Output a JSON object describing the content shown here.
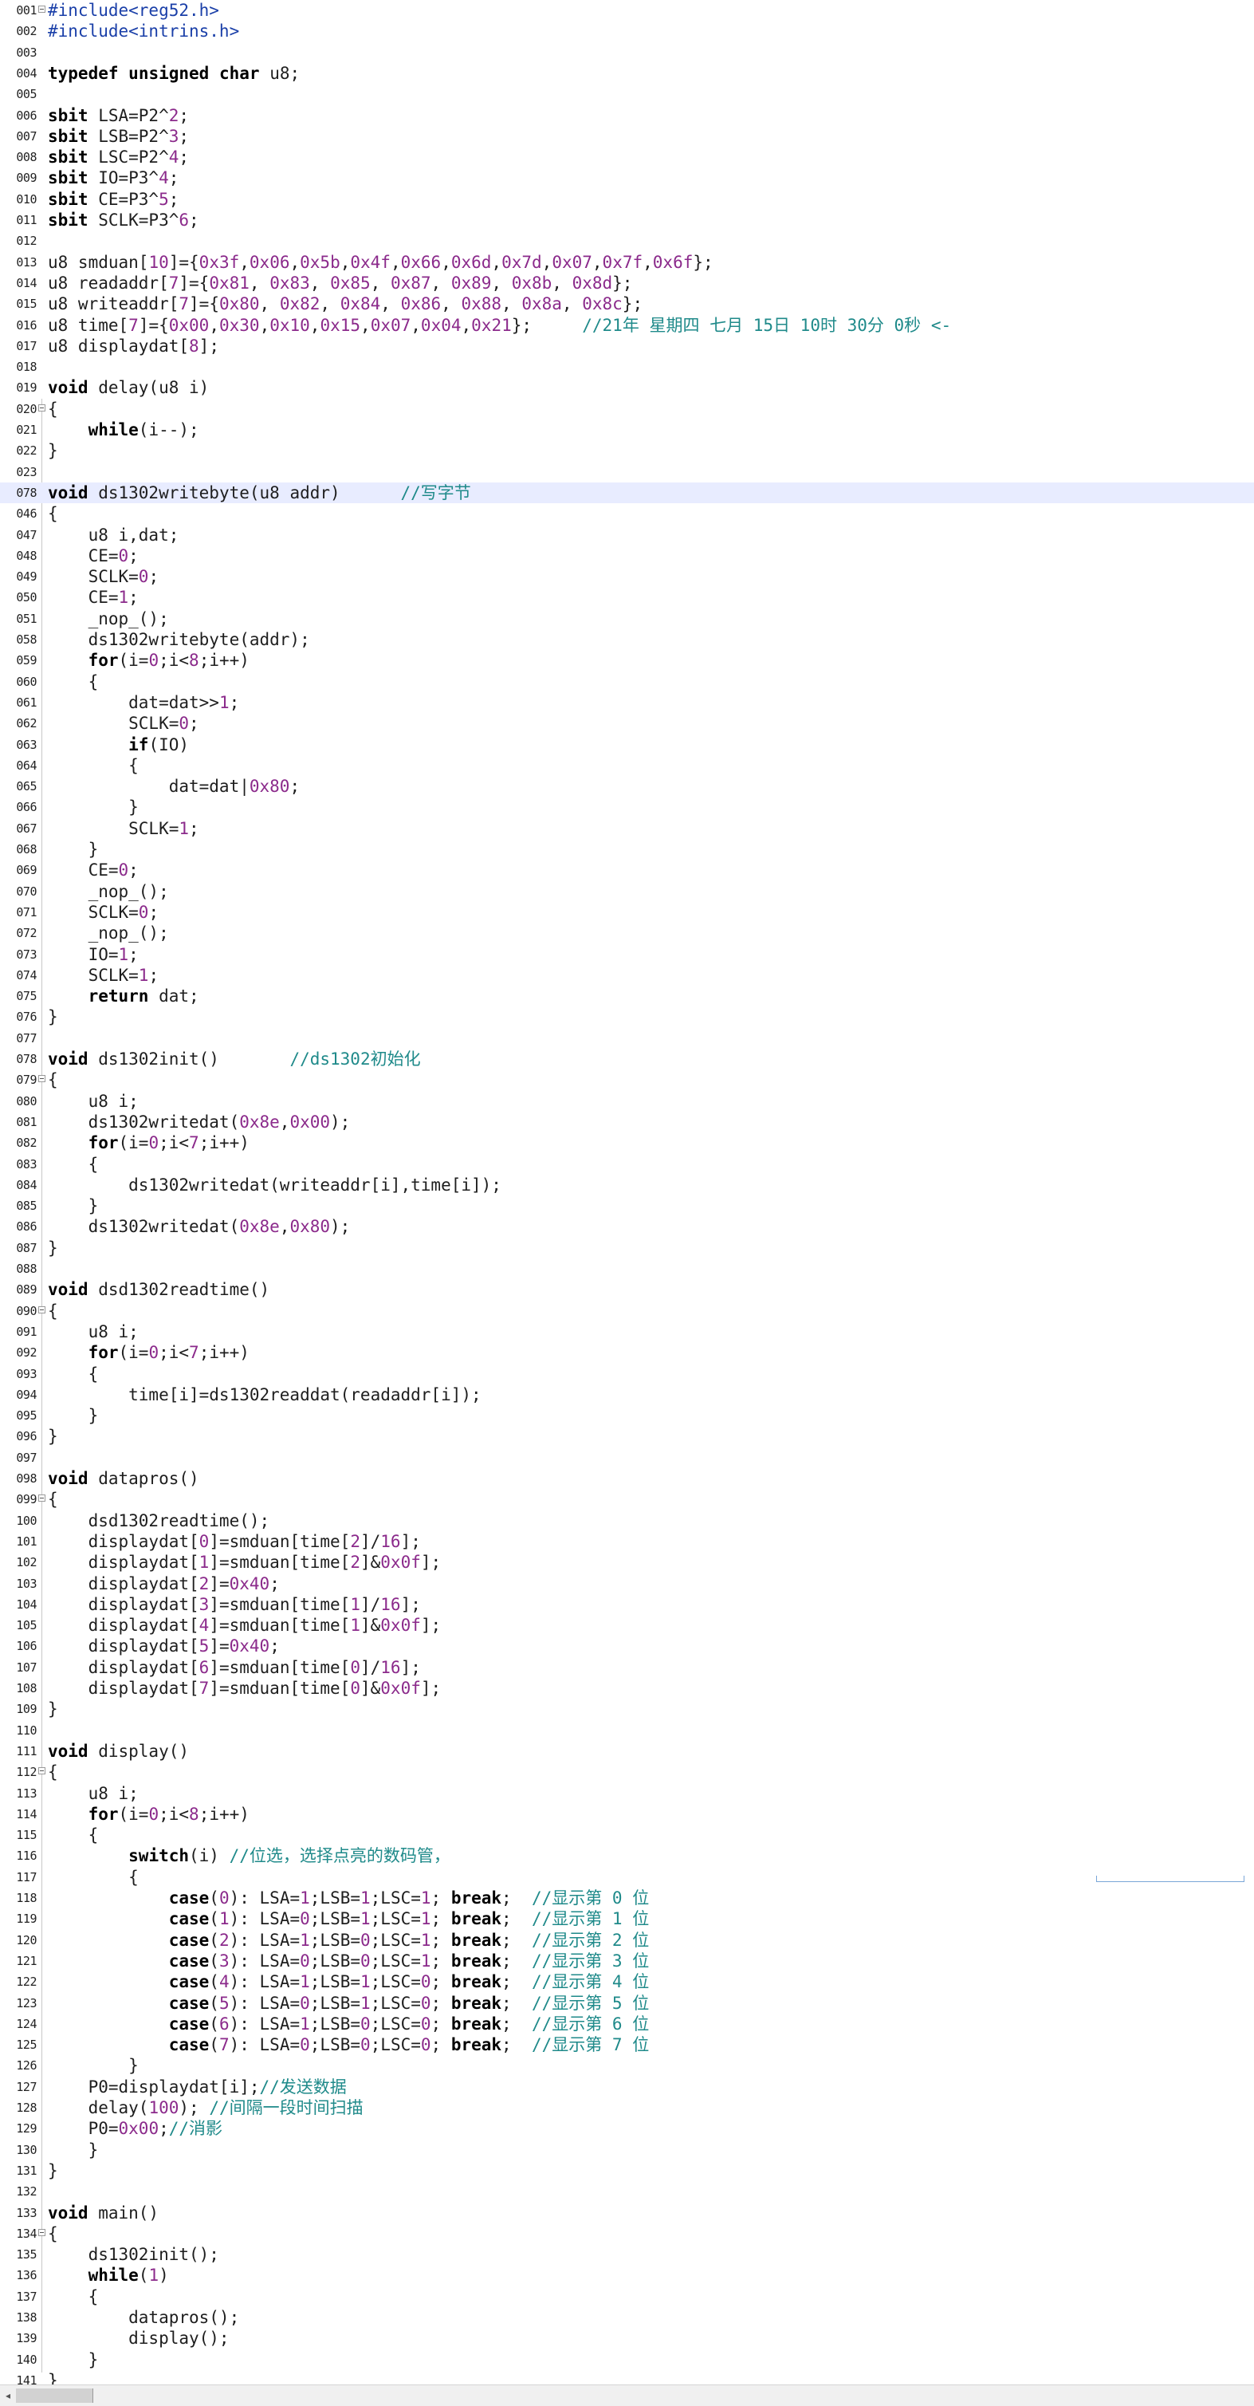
{
  "editor": {
    "lines": [
      {
        "n": "001",
        "fold": "box",
        "t": "#include<reg52.h>"
      },
      {
        "n": "002",
        "t": "#include<intrins.h>"
      },
      {
        "n": "003",
        "t": ""
      },
      {
        "n": "004",
        "t": "typedef unsigned char u8;"
      },
      {
        "n": "005",
        "t": ""
      },
      {
        "n": "006",
        "t": "sbit LSA=P2^2;"
      },
      {
        "n": "007",
        "t": "sbit LSB=P2^3;"
      },
      {
        "n": "008",
        "t": "sbit LSC=P2^4;"
      },
      {
        "n": "009",
        "t": "sbit IO=P3^4;"
      },
      {
        "n": "010",
        "t": "sbit CE=P3^5;"
      },
      {
        "n": "011",
        "t": "sbit SCLK=P3^6;"
      },
      {
        "n": "012",
        "t": ""
      },
      {
        "n": "013",
        "t": "u8 smduan[10]={0x3f,0x06,0x5b,0x4f,0x66,0x6d,0x7d,0x07,0x7f,0x6f};"
      },
      {
        "n": "014",
        "t": "u8 readaddr[7]={0x81, 0x83, 0x85, 0x87, 0x89, 0x8b, 0x8d};"
      },
      {
        "n": "015",
        "t": "u8 writeaddr[7]={0x80, 0x82, 0x84, 0x86, 0x88, 0x8a, 0x8c};"
      },
      {
        "n": "016",
        "t": "u8 time[7]={0x00,0x30,0x10,0x15,0x07,0x04,0x21};     //21年 星期四 七月 15日 10时 30分 0秒 <-"
      },
      {
        "n": "017",
        "t": "u8 displaydat[8];"
      },
      {
        "n": "018",
        "t": ""
      },
      {
        "n": "019",
        "t": "void delay(u8 i)"
      },
      {
        "n": "020",
        "fold": "box",
        "t": "{"
      },
      {
        "n": "021",
        "t": "    while(i--);"
      },
      {
        "n": "022",
        "t": "}"
      },
      {
        "n": "023",
        "t": ""
      },
      {
        "n": "078",
        "hl": true,
        "t": "void ds1302writebyte(u8 addr)      //写字节"
      },
      {
        "n": "046",
        "t": "{"
      },
      {
        "n": "047",
        "t": "    u8 i,dat;"
      },
      {
        "n": "048",
        "t": "    CE=0;"
      },
      {
        "n": "049",
        "t": "    SCLK=0;"
      },
      {
        "n": "050",
        "t": "    CE=1;"
      },
      {
        "n": "051",
        "t": "    _nop_();"
      },
      {
        "n": "058",
        "t": "    ds1302writebyte(addr);"
      },
      {
        "n": "059",
        "t": "    for(i=0;i<8;i++)"
      },
      {
        "n": "060",
        "t": "    {"
      },
      {
        "n": "061",
        "t": "        dat=dat>>1;"
      },
      {
        "n": "062",
        "t": "        SCLK=0;"
      },
      {
        "n": "063",
        "t": "        if(IO)"
      },
      {
        "n": "064",
        "t": "        {"
      },
      {
        "n": "065",
        "t": "            dat=dat|0x80;"
      },
      {
        "n": "066",
        "t": "        }"
      },
      {
        "n": "067",
        "t": "        SCLK=1;"
      },
      {
        "n": "068",
        "t": "    }"
      },
      {
        "n": "069",
        "t": "    CE=0;"
      },
      {
        "n": "070",
        "t": "    _nop_();"
      },
      {
        "n": "071",
        "t": "    SCLK=0;"
      },
      {
        "n": "072",
        "t": "    _nop_();"
      },
      {
        "n": "073",
        "t": "    IO=1;"
      },
      {
        "n": "074",
        "t": "    SCLK=1;"
      },
      {
        "n": "075",
        "t": "    return dat;"
      },
      {
        "n": "076",
        "t": "}"
      },
      {
        "n": "077",
        "t": ""
      },
      {
        "n": "078",
        "t": "void ds1302init()       //ds1302初始化"
      },
      {
        "n": "079",
        "fold": "box",
        "t": "{"
      },
      {
        "n": "080",
        "t": "    u8 i;"
      },
      {
        "n": "081",
        "t": "    ds1302writedat(0x8e,0x00);"
      },
      {
        "n": "082",
        "t": "    for(i=0;i<7;i++)"
      },
      {
        "n": "083",
        "t": "    {"
      },
      {
        "n": "084",
        "t": "        ds1302writedat(writeaddr[i],time[i]);"
      },
      {
        "n": "085",
        "t": "    }"
      },
      {
        "n": "086",
        "t": "    ds1302writedat(0x8e,0x80);"
      },
      {
        "n": "087",
        "t": "}"
      },
      {
        "n": "088",
        "t": ""
      },
      {
        "n": "089",
        "t": "void dsd1302readtime()"
      },
      {
        "n": "090",
        "fold": "box",
        "t": "{"
      },
      {
        "n": "091",
        "t": "    u8 i;"
      },
      {
        "n": "092",
        "t": "    for(i=0;i<7;i++)"
      },
      {
        "n": "093",
        "t": "    {"
      },
      {
        "n": "094",
        "t": "        time[i]=ds1302readdat(readaddr[i]);"
      },
      {
        "n": "095",
        "t": "    }"
      },
      {
        "n": "096",
        "t": "}"
      },
      {
        "n": "097",
        "t": ""
      },
      {
        "n": "098",
        "t": "void datapros()"
      },
      {
        "n": "099",
        "fold": "box",
        "t": "{"
      },
      {
        "n": "100",
        "t": "    dsd1302readtime();"
      },
      {
        "n": "101",
        "t": "    displaydat[0]=smduan[time[2]/16];"
      },
      {
        "n": "102",
        "t": "    displaydat[1]=smduan[time[2]&0x0f];"
      },
      {
        "n": "103",
        "t": "    displaydat[2]=0x40;"
      },
      {
        "n": "104",
        "t": "    displaydat[3]=smduan[time[1]/16];"
      },
      {
        "n": "105",
        "t": "    displaydat[4]=smduan[time[1]&0x0f];"
      },
      {
        "n": "106",
        "t": "    displaydat[5]=0x40;"
      },
      {
        "n": "107",
        "t": "    displaydat[6]=smduan[time[0]/16];"
      },
      {
        "n": "108",
        "t": "    displaydat[7]=smduan[time[0]&0x0f];"
      },
      {
        "n": "109",
        "t": "}"
      },
      {
        "n": "110",
        "t": ""
      },
      {
        "n": "111",
        "t": "void display()"
      },
      {
        "n": "112",
        "fold": "box",
        "t": "{"
      },
      {
        "n": "113",
        "t": "    u8 i;"
      },
      {
        "n": "114",
        "t": "    for(i=0;i<8;i++)"
      },
      {
        "n": "115",
        "t": "    {"
      },
      {
        "n": "116",
        "t": "        switch(i) //位选，选择点亮的数码管，"
      },
      {
        "n": "117",
        "t": "        {"
      },
      {
        "n": "118",
        "t": "            case(0): LSA=1;LSB=1;LSC=1; break;  //显示第 0 位"
      },
      {
        "n": "119",
        "t": "            case(1): LSA=0;LSB=1;LSC=1; break;  //显示第 1 位"
      },
      {
        "n": "120",
        "t": "            case(2): LSA=1;LSB=0;LSC=1; break;  //显示第 2 位"
      },
      {
        "n": "121",
        "t": "            case(3): LSA=0;LSB=0;LSC=1; break;  //显示第 3 位"
      },
      {
        "n": "122",
        "t": "            case(4): LSA=1;LSB=1;LSC=0; break;  //显示第 4 位"
      },
      {
        "n": "123",
        "t": "            case(5): LSA=0;LSB=1;LSC=0; break;  //显示第 5 位"
      },
      {
        "n": "124",
        "t": "            case(6): LSA=1;LSB=0;LSC=0; break;  //显示第 6 位"
      },
      {
        "n": "125",
        "t": "            case(7): LSA=0;LSB=0;LSC=0; break;  //显示第 7 位"
      },
      {
        "n": "126",
        "t": "        }"
      },
      {
        "n": "127",
        "t": "    P0=displaydat[i];//发送数据"
      },
      {
        "n": "128",
        "t": "    delay(100); //间隔一段时间扫描"
      },
      {
        "n": "129",
        "t": "    P0=0x00;//消影"
      },
      {
        "n": "130",
        "t": "    }"
      },
      {
        "n": "131",
        "t": "}"
      },
      {
        "n": "132",
        "t": ""
      },
      {
        "n": "133",
        "t": "void main()"
      },
      {
        "n": "134",
        "fold": "box",
        "t": "{"
      },
      {
        "n": "135",
        "t": "    ds1302init();"
      },
      {
        "n": "136",
        "t": "    while(1)"
      },
      {
        "n": "137",
        "t": "    {"
      },
      {
        "n": "138",
        "t": "        datapros();"
      },
      {
        "n": "139",
        "t": "        display();"
      },
      {
        "n": "140",
        "t": "    }"
      },
      {
        "n": "141",
        "t": "}"
      }
    ]
  },
  "scrollbar": {
    "left_arrow": "◂"
  },
  "colors": {
    "keyword": "#000000",
    "number": "#8b2a8b",
    "comment": "#1f8a8a",
    "preprocessor": "#1a3fa8",
    "highlight": "#e8ecff"
  }
}
